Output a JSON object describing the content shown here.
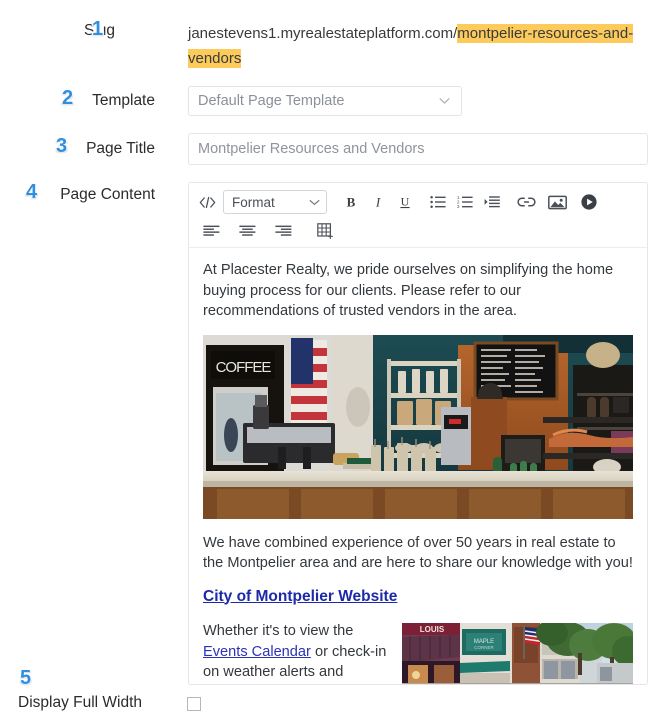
{
  "form": {
    "rows": [
      {
        "step": "1",
        "label": "Slug"
      },
      {
        "step": "2",
        "label": "Template"
      },
      {
        "step": "3",
        "label": "Page Title"
      },
      {
        "step": "4",
        "label": "Page Content"
      },
      {
        "step": "5",
        "label": "Display Full Width"
      }
    ]
  },
  "slug": {
    "domain": "janestevens1.myrealestateplatform.com/",
    "highlighted": "montpelier-resources-and-vendors",
    "highlight_color": "#fccb5c"
  },
  "template": {
    "selected": "Default Page Template",
    "chevron": "chevron-down-icon"
  },
  "page_title": {
    "value": "Montpelier Resources and Vendors"
  },
  "editor": {
    "toolbar": {
      "row1": [
        {
          "name": "code-view-icon",
          "label": "</>"
        },
        {
          "name": "format-dropdown",
          "label": "Format"
        },
        {
          "name": "bold-icon",
          "label": "B"
        },
        {
          "name": "italic-icon",
          "label": "I"
        },
        {
          "name": "underline-icon",
          "label": "U"
        },
        {
          "name": "unordered-list-icon",
          "label": "Bulleted List"
        },
        {
          "name": "ordered-list-icon",
          "label": "Numbered List"
        },
        {
          "name": "indent-icon",
          "label": "Indent"
        },
        {
          "name": "link-icon",
          "label": "Insert Link"
        },
        {
          "name": "image-icon",
          "label": "Insert Image"
        },
        {
          "name": "video-icon",
          "label": "Insert Video"
        }
      ],
      "row2": [
        {
          "name": "align-left-icon",
          "label": "Align Left"
        },
        {
          "name": "align-center-icon",
          "label": "Align Center"
        },
        {
          "name": "align-right-icon",
          "label": "Align Right"
        },
        {
          "name": "insert-table-icon",
          "label": "Insert Table"
        }
      ]
    },
    "content": {
      "paragraph_1": "At Placester Realty, we pride ourselves on simplifying the home buying process for our clients. Please refer to our recommendations of trusted vendors in the area.",
      "image_1": "coffee-shop-interior-photo",
      "paragraph_2": "We have combined experience of over 50 years in real estate to the Montpelier area and are here to share our knowledge with you!",
      "link_1": "City of Montpelier Website",
      "paragraph_3_before": "Whether it's to view the ",
      "link_2": "Events Calendar",
      "paragraph_3_after": " or check-in on weather alerts and parking",
      "image_2": "montpelier-street-storefronts-photo"
    }
  },
  "display_full_width": {
    "label": "Display Full Width",
    "checked": false
  }
}
